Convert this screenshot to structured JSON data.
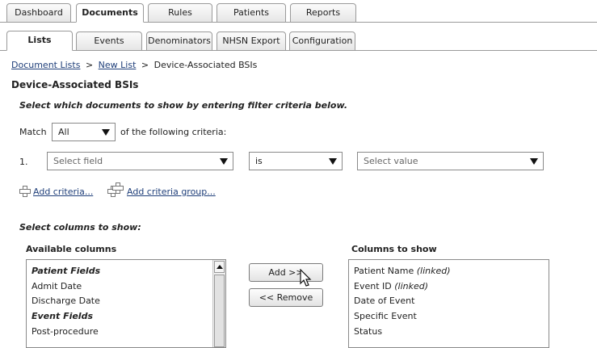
{
  "top_tabs": [
    "Dashboard",
    "Documents",
    "Rules",
    "Patients",
    "Reports"
  ],
  "sub_tabs": [
    "Lists",
    "Events",
    "Denominators",
    "NHSN Export",
    "Configuration"
  ],
  "breadcrumb": {
    "item1": "Document Lists",
    "sep1": ">",
    "item2": "New List",
    "sep2": ">",
    "current": "Device-Associated BSIs"
  },
  "page_title": "Device-Associated BSIs",
  "instruction": "Select which documents to show by entering filter criteria below.",
  "match": {
    "label": "Match",
    "value": "All",
    "suffix": "of the following criteria:"
  },
  "criteria": {
    "number": "1.",
    "field_placeholder": "Select field",
    "operator": "is",
    "value_placeholder": "Select value"
  },
  "add_criteria": "Add criteria...",
  "add_group": "Add criteria group...",
  "columns_heading": "Select columns to show:",
  "available": {
    "title": "Available columns",
    "items": [
      {
        "text": "Patient Fields",
        "group": true
      },
      {
        "text": "Admit Date",
        "group": false
      },
      {
        "text": "Discharge Date",
        "group": false
      },
      {
        "text": "Event Fields",
        "group": true
      },
      {
        "text": "Post-procedure",
        "group": false
      }
    ]
  },
  "buttons": {
    "add": "Add >>",
    "remove": "<< Remove"
  },
  "shown": {
    "title": "Columns to show",
    "items": [
      {
        "text": "Patient Name",
        "note": "(linked)"
      },
      {
        "text": "Event ID",
        "note": "(linked)"
      },
      {
        "text": "Date of Event",
        "note": ""
      },
      {
        "text": "Specific Event",
        "note": ""
      },
      {
        "text": "Status",
        "note": ""
      }
    ]
  },
  "colors": {
    "link": "#1f3f7a",
    "border": "#9a9a9a"
  }
}
